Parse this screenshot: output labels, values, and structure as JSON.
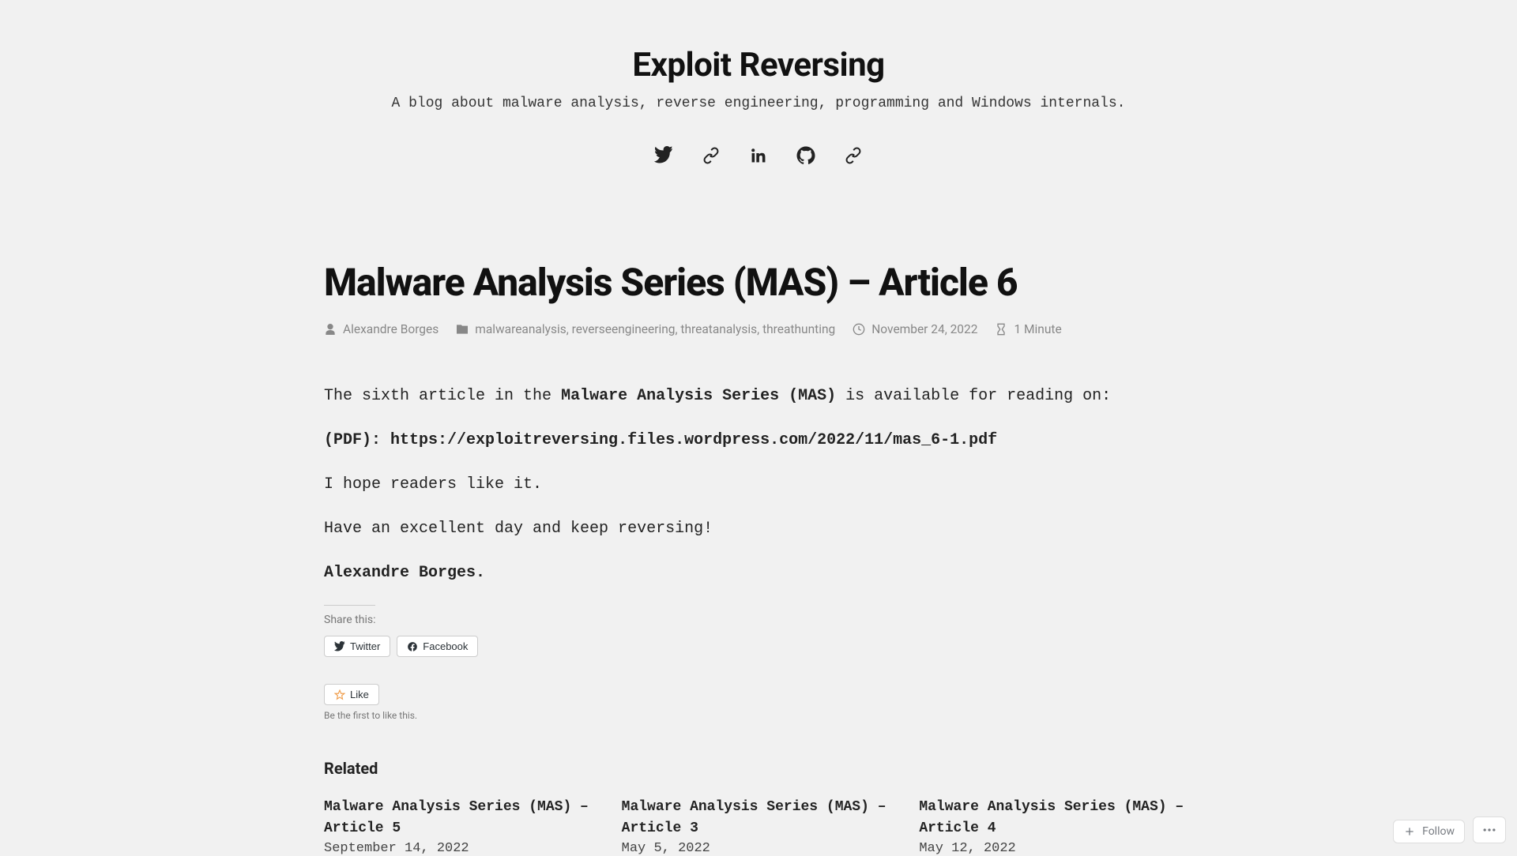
{
  "header": {
    "site_title": "Exploit Reversing",
    "tagline": "A blog about malware analysis, reverse engineering, programming and Windows internals."
  },
  "social": {
    "twitter_name": "twitter-icon",
    "link1_name": "link-icon",
    "linkedin_name": "linkedin-icon",
    "github_name": "github-icon",
    "link2_name": "link-icon"
  },
  "article": {
    "title": "Malware Analysis Series (MAS) – Article 6",
    "meta": {
      "author": "Alexandre Borges",
      "tags": [
        "malwareanalysis",
        "reverseengineering",
        "threatanalysis",
        "threathunting"
      ],
      "date": "November 24, 2022",
      "read_time": "1 Minute"
    },
    "body": {
      "p1_prefix": "The sixth article in the ",
      "p1_bold": "Malware Analysis Series (MAS)",
      "p1_suffix": " is available for reading on:",
      "p2_label": "(PDF): ",
      "p2_link": "https://exploitreversing.files.wordpress.com/2022/11/mas_6-1.pdf",
      "p3": "I hope readers like it.",
      "p4": "Have an excellent day and keep reversing!",
      "signature": "Alexandre Borges."
    }
  },
  "share": {
    "label": "Share this:",
    "twitter": "Twitter",
    "facebook": "Facebook"
  },
  "like": {
    "button": "Like",
    "note": "Be the first to like this."
  },
  "related": {
    "heading": "Related",
    "items": [
      {
        "title": "Malware Analysis Series (MAS) – Article 5",
        "date": "September 14, 2022"
      },
      {
        "title": "Malware Analysis Series (MAS) – Article 3",
        "date": "May 5, 2022"
      },
      {
        "title": "Malware Analysis Series (MAS) – Article 4",
        "date": "May 12, 2022"
      }
    ]
  },
  "footer": {
    "follow": "Follow"
  }
}
